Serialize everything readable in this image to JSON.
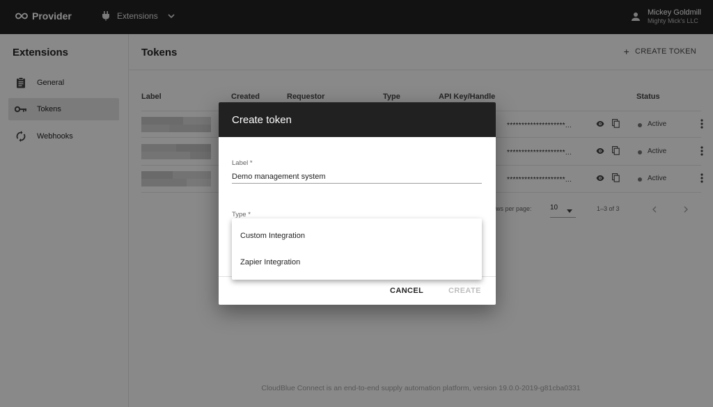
{
  "topbar": {
    "brand": "Provider",
    "extensions_label": "Extensions",
    "user_name": "Mickey Goldmill",
    "user_org": "Mighty Mick's LLC"
  },
  "sidebar": {
    "title": "Extensions",
    "items": [
      {
        "label": "General",
        "icon": "clipboard-icon"
      },
      {
        "label": "Tokens",
        "icon": "key-icon",
        "active": true
      },
      {
        "label": "Webhooks",
        "icon": "sync-icon"
      }
    ]
  },
  "main": {
    "title": "Tokens",
    "create_button": "CREATE TOKEN",
    "columns": [
      "Label",
      "Created",
      "Requestor",
      "Type",
      "API Key/Handle",
      "Status"
    ],
    "rows": [
      {
        "key": "********************...",
        "status": "Active"
      },
      {
        "key": "********************...",
        "status": "Active"
      },
      {
        "key": "********************...",
        "status": "Active"
      }
    ],
    "pagination": {
      "rows_per_page_label": "ows per page:",
      "rows_per_page": "10",
      "range": "1–3 of 3"
    },
    "footer": "CloudBlue Connect is an end-to-end supply automation platform, version 19.0.0-2019-g81cba0331"
  },
  "dialog": {
    "title": "Create token",
    "label_field": {
      "label": "Label *",
      "value": "Demo management system"
    },
    "type_field": {
      "label": "Type *"
    },
    "type_options": [
      "Custom Integration",
      "Zapier Integration"
    ],
    "cancel": "CANCEL",
    "create": "CREATE"
  },
  "colors": {
    "topbar": "#212121",
    "dialog_header": "#212121",
    "active_nav": "#e0e0e0",
    "status_dot": "#757575"
  }
}
